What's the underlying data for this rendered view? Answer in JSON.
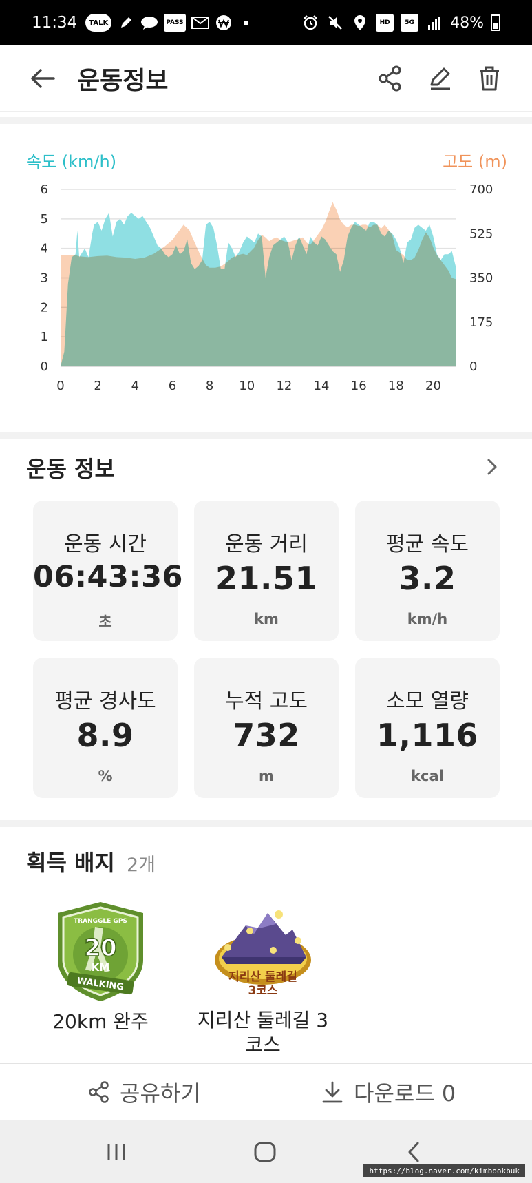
{
  "status_bar": {
    "time": "11:34",
    "left_icons": [
      "TALK",
      "pen-icon",
      "chat-icon",
      "PASS",
      "mail-icon",
      "won-icon"
    ],
    "right_icons": [
      "alarm-icon",
      "mute-icon",
      "location-icon",
      "HD",
      "5G",
      "signal-icon"
    ],
    "battery": "48%"
  },
  "header": {
    "title": "운동정보"
  },
  "chart": {
    "legend_left": "속도 (km/h)",
    "legend_right": "고도 (m)"
  },
  "chart_data": {
    "type": "area",
    "title": "",
    "xlabel": "",
    "ylabel_left": "속도 (km/h)",
    "ylabel_right": "고도 (m)",
    "x_ticks": [
      0,
      2,
      4,
      6,
      8,
      10,
      12,
      14,
      16,
      18,
      20
    ],
    "left_ticks": [
      0,
      1,
      2,
      3,
      4,
      5,
      6
    ],
    "right_ticks": [
      0,
      175,
      350,
      525,
      700
    ],
    "xlim": [
      0,
      21.2
    ],
    "ylim_left": [
      0,
      6
    ],
    "ylim_right": [
      0,
      700
    ],
    "grid": true,
    "series": [
      {
        "name": "속도 (km/h)",
        "axis": "left",
        "color": "#8fdfe3",
        "x": [
          0,
          0.2,
          0.4,
          0.6,
          0.8,
          0.9,
          1.0,
          1.1,
          1.3,
          1.5,
          1.7,
          1.8,
          2.0,
          2.2,
          2.4,
          2.6,
          2.8,
          3.0,
          3.2,
          3.4,
          3.6,
          3.8,
          4.0,
          4.2,
          4.4,
          4.6,
          4.8,
          5.0,
          5.2,
          5.4,
          5.6,
          5.8,
          6.0,
          6.2,
          6.4,
          6.6,
          6.8,
          7.0,
          7.2,
          7.4,
          7.6,
          7.8,
          8.0,
          8.2,
          8.4,
          8.6,
          8.8,
          9.0,
          9.2,
          9.4,
          9.6,
          9.8,
          10.0,
          10.2,
          10.4,
          10.6,
          10.8,
          11.0,
          11.2,
          11.4,
          11.6,
          11.8,
          12.0,
          12.2,
          12.4,
          12.6,
          12.8,
          13.0,
          13.2,
          13.4,
          13.6,
          13.8,
          14.0,
          14.2,
          14.4,
          14.6,
          14.8,
          15.0,
          15.2,
          15.4,
          15.6,
          15.8,
          16.0,
          16.2,
          16.4,
          16.6,
          16.8,
          17.0,
          17.2,
          17.4,
          17.6,
          17.8,
          18.0,
          18.2,
          18.4,
          18.6,
          18.8,
          19.0,
          19.2,
          19.4,
          19.6,
          19.8,
          20.0,
          20.2,
          20.4,
          20.6,
          20.8,
          21.0,
          21.2
        ],
        "values": [
          0,
          0.5,
          2.8,
          3.7,
          3.8,
          4.6,
          3.7,
          3.8,
          4.0,
          3.7,
          4.5,
          4.8,
          4.9,
          4.6,
          5.0,
          5.2,
          4.4,
          4.9,
          5.0,
          4.8,
          5.1,
          5.2,
          5.1,
          5.0,
          5.1,
          4.9,
          4.7,
          4.4,
          4.1,
          4.0,
          3.8,
          3.7,
          3.8,
          4.1,
          3.8,
          3.9,
          4.3,
          3.5,
          3.3,
          3.4,
          3.6,
          4.8,
          4.9,
          4.7,
          4.1,
          3.3,
          3.3,
          4.2,
          4.0,
          3.7,
          3.9,
          4.2,
          4.4,
          4.3,
          4.2,
          4.5,
          4.4,
          3.0,
          3.7,
          4.1,
          4.2,
          4.3,
          4.4,
          4.2,
          3.6,
          4.1,
          4.4,
          4.1,
          3.8,
          4.4,
          4.2,
          4.1,
          4.4,
          4.3,
          4.1,
          3.9,
          3.8,
          3.2,
          3.6,
          4.4,
          4.7,
          4.9,
          4.8,
          4.7,
          4.6,
          4.9,
          4.9,
          4.8,
          4.5,
          4.4,
          4.6,
          4.5,
          4.3,
          4.0,
          3.5,
          4.2,
          4.3,
          4.7,
          4.8,
          4.7,
          4.6,
          4.8,
          4.4,
          3.8,
          3.6,
          3.8,
          3.8,
          3.9,
          3.4
        ]
      },
      {
        "name": "고도 (m)",
        "axis": "right",
        "color": "#f8bf98",
        "x": [
          0,
          0.2,
          0.4,
          0.6,
          0.8,
          1.0,
          1.5,
          2.0,
          2.5,
          3.0,
          3.5,
          4.0,
          4.5,
          5.0,
          5.3,
          5.6,
          6.0,
          6.3,
          6.6,
          6.9,
          7.2,
          7.5,
          7.8,
          8.0,
          8.3,
          8.6,
          8.9,
          9.2,
          9.5,
          9.8,
          10.0,
          10.2,
          10.4,
          10.6,
          10.8,
          11.0,
          11.2,
          11.4,
          11.6,
          11.8,
          12.0,
          12.2,
          12.4,
          12.6,
          12.8,
          13.0,
          13.2,
          13.4,
          13.6,
          13.8,
          14.0,
          14.2,
          14.4,
          14.6,
          14.8,
          15.0,
          15.2,
          15.4,
          15.6,
          15.8,
          16.0,
          16.2,
          16.4,
          16.6,
          16.8,
          17.0,
          17.2,
          17.4,
          17.6,
          17.8,
          18.0,
          18.2,
          18.4,
          18.6,
          18.8,
          19.0,
          19.2,
          19.4,
          19.6,
          19.8,
          20.0,
          20.2,
          20.4,
          20.6,
          20.8,
          21.0,
          21.2
        ],
        "values": [
          440,
          440,
          440,
          440,
          440,
          435,
          432,
          436,
          438,
          432,
          430,
          425,
          430,
          445,
          460,
          475,
          500,
          530,
          560,
          540,
          490,
          440,
          400,
          390,
          390,
          395,
          410,
          430,
          440,
          445,
          440,
          455,
          470,
          500,
          520,
          510,
          495,
          505,
          510,
          500,
          495,
          490,
          495,
          500,
          505,
          510,
          490,
          480,
          500,
          520,
          540,
          570,
          610,
          650,
          620,
          580,
          560,
          550,
          560,
          560,
          555,
          560,
          560,
          550,
          560,
          560,
          545,
          560,
          540,
          520,
          460,
          450,
          440,
          420,
          420,
          430,
          460,
          500,
          530,
          510,
          470,
          440,
          420,
          400,
          380,
          350,
          345
        ]
      }
    ]
  },
  "info": {
    "title": "운동 정보",
    "stats": [
      {
        "label": "운동 시간",
        "value": "06:43:36",
        "unit": "초"
      },
      {
        "label": "운동 거리",
        "value": "21.51",
        "unit": "km"
      },
      {
        "label": "평균 속도",
        "value": "3.2",
        "unit": "km/h"
      },
      {
        "label": "평균 경사도",
        "value": "8.9",
        "unit": "%"
      },
      {
        "label": "누적 고도",
        "value": "732",
        "unit": "m"
      },
      {
        "label": "소모 열량",
        "value": "1,116",
        "unit": "kcal"
      }
    ]
  },
  "badges": {
    "title": "획득 배지",
    "count": "2개",
    "items": [
      {
        "name": "20km 완주",
        "emblem_top": "TRANGGLE GPS",
        "emblem_num": "20",
        "emblem_unit": "KM",
        "emblem_bottom": "WALKING"
      },
      {
        "name": "지리산 둘레길 3코스",
        "emblem_line1": "지리산 둘레길",
        "emblem_line2": "3코스"
      }
    ]
  },
  "actions": {
    "share": "공유하기",
    "download": "다운로드 0"
  },
  "watermark": "https://blog.naver.com/kimbookbuk"
}
